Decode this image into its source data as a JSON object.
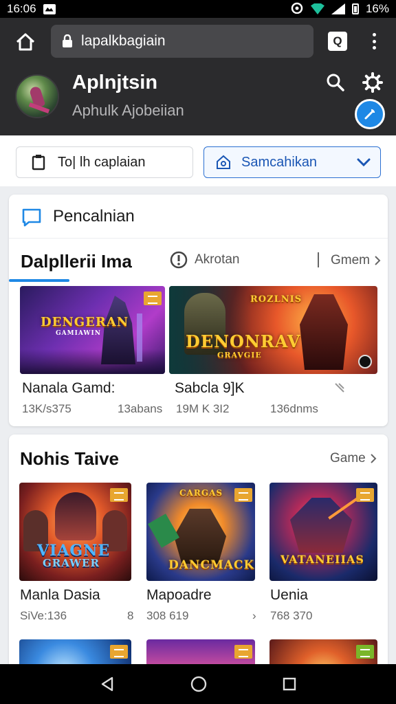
{
  "status_bar": {
    "time": "16:06",
    "battery": "16%"
  },
  "browser": {
    "url": "lapalkbagiain",
    "tabs_count": "Q"
  },
  "app": {
    "title": "Aplnjtsin",
    "subtitle": "Aphulk Ajobeiian"
  },
  "toolbar": {
    "left_label": "To| lh caplaian",
    "right_label": "Samcahikan"
  },
  "section1": {
    "search_label": "Pencalnian",
    "title": "Dalpllerii Ima",
    "filter_label": "Akrotan",
    "more_label": "Gmem",
    "games": [
      {
        "name": "Nanala Gamd:",
        "meta_left": "13K/s375",
        "meta_right": "13abans",
        "logo": "DENGERAN",
        "logo_sub": "GAMIAWIN"
      },
      {
        "name": "Sabcla 9]K",
        "meta_left": "19M K 3I2",
        "meta_right": "136dnms",
        "logo": "DENONRAV",
        "logo_sub": "GRAVGIE",
        "corner_logo": "ROZLNIS"
      }
    ]
  },
  "section2": {
    "title": "Nohis Taive",
    "more_label": "Game",
    "games": [
      {
        "name": "Manla Dasia",
        "meta_left": "SiVe:136",
        "meta_right": "8",
        "logo": "VIAGNE",
        "logo_sub": "GRAWER"
      },
      {
        "name": "Mapoadre",
        "meta_left": "308 619",
        "meta_right": "›",
        "logo": "DANCMACK",
        "logo_top": "CARGAS"
      },
      {
        "name": "Uenia",
        "meta_left": "768 370",
        "meta_right": "",
        "logo": "VATANEIIAS"
      }
    ]
  },
  "colors": {
    "accent": "#1e88e5",
    "header_bg": "#2b2b2d",
    "badge": "#e8a630"
  }
}
